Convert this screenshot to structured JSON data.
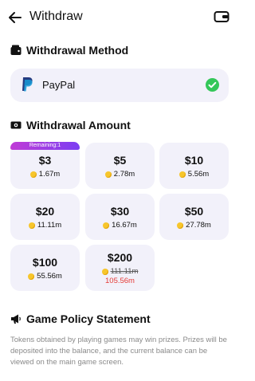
{
  "header": {
    "title": "Withdraw"
  },
  "withdrawal_method": {
    "section_title": "Withdrawal Method",
    "method_name": "PayPal"
  },
  "withdrawal_amount": {
    "section_title": "Withdrawal Amount",
    "options": [
      {
        "amount": "$3",
        "coins": "1.67m",
        "badge": "Remaining:1"
      },
      {
        "amount": "$5",
        "coins": "2.78m"
      },
      {
        "amount": "$10",
        "coins": "5.56m"
      },
      {
        "amount": "$20",
        "coins": "11.11m"
      },
      {
        "amount": "$30",
        "coins": "16.67m"
      },
      {
        "amount": "$50",
        "coins": "27.78m"
      },
      {
        "amount": "$100",
        "coins": "55.56m"
      },
      {
        "amount": "$200",
        "coins": "111.11m",
        "sale_coins": "105.56m"
      }
    ]
  },
  "policy": {
    "section_title": "Game Policy Statement",
    "text": "Tokens obtained by playing games may win prizes. Prizes will be deposited into the balance, and the current balance can be viewed on the main game screen."
  },
  "colors": {
    "accent_badge": "#9b3ee6",
    "check_green": "#34c759",
    "tile_bg": "#f2f1fa",
    "sale_red": "#e53935",
    "coin": "#f7c62c"
  }
}
